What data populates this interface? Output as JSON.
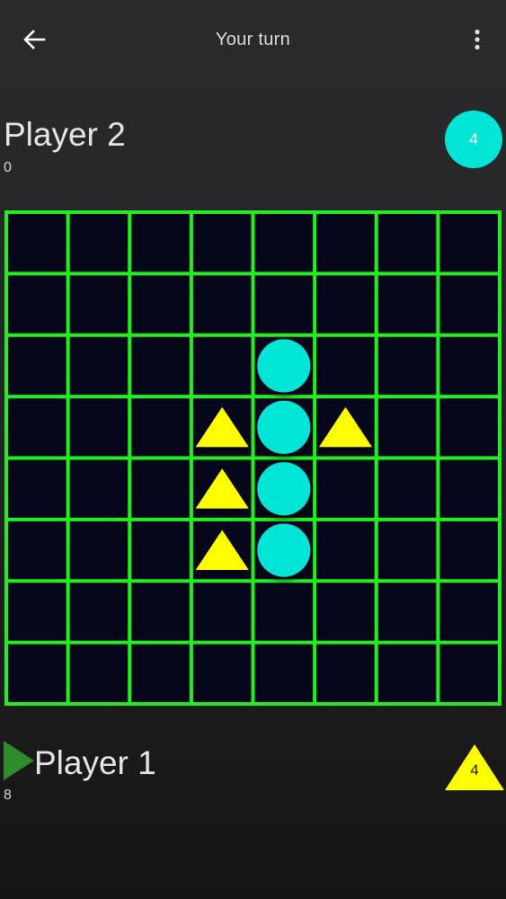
{
  "header": {
    "title": "Your turn",
    "back_icon": "arrow-left-icon",
    "menu_icon": "more-vert-icon"
  },
  "player2": {
    "name": "Player 2",
    "score": "0",
    "piece": "circle",
    "badge_value": "4",
    "color": "#00e5d6"
  },
  "player1": {
    "name": "Player 1",
    "score": "8",
    "piece": "triangle",
    "badge_value": "4",
    "color": "#ffff00",
    "turn_indicator_icon": "play-arrow-icon",
    "turn_indicator_color": "#2e8b2e"
  },
  "board": {
    "rows": 8,
    "cols": 8,
    "grid_color": "#22ee22",
    "cell_color": "#07071c",
    "pieces": [
      {
        "row": 2,
        "col": 4,
        "type": "circle"
      },
      {
        "row": 3,
        "col": 3,
        "type": "triangle"
      },
      {
        "row": 3,
        "col": 4,
        "type": "circle"
      },
      {
        "row": 3,
        "col": 5,
        "type": "triangle"
      },
      {
        "row": 4,
        "col": 3,
        "type": "triangle"
      },
      {
        "row": 4,
        "col": 4,
        "type": "circle"
      },
      {
        "row": 5,
        "col": 3,
        "type": "triangle"
      },
      {
        "row": 5,
        "col": 4,
        "type": "circle"
      }
    ]
  }
}
